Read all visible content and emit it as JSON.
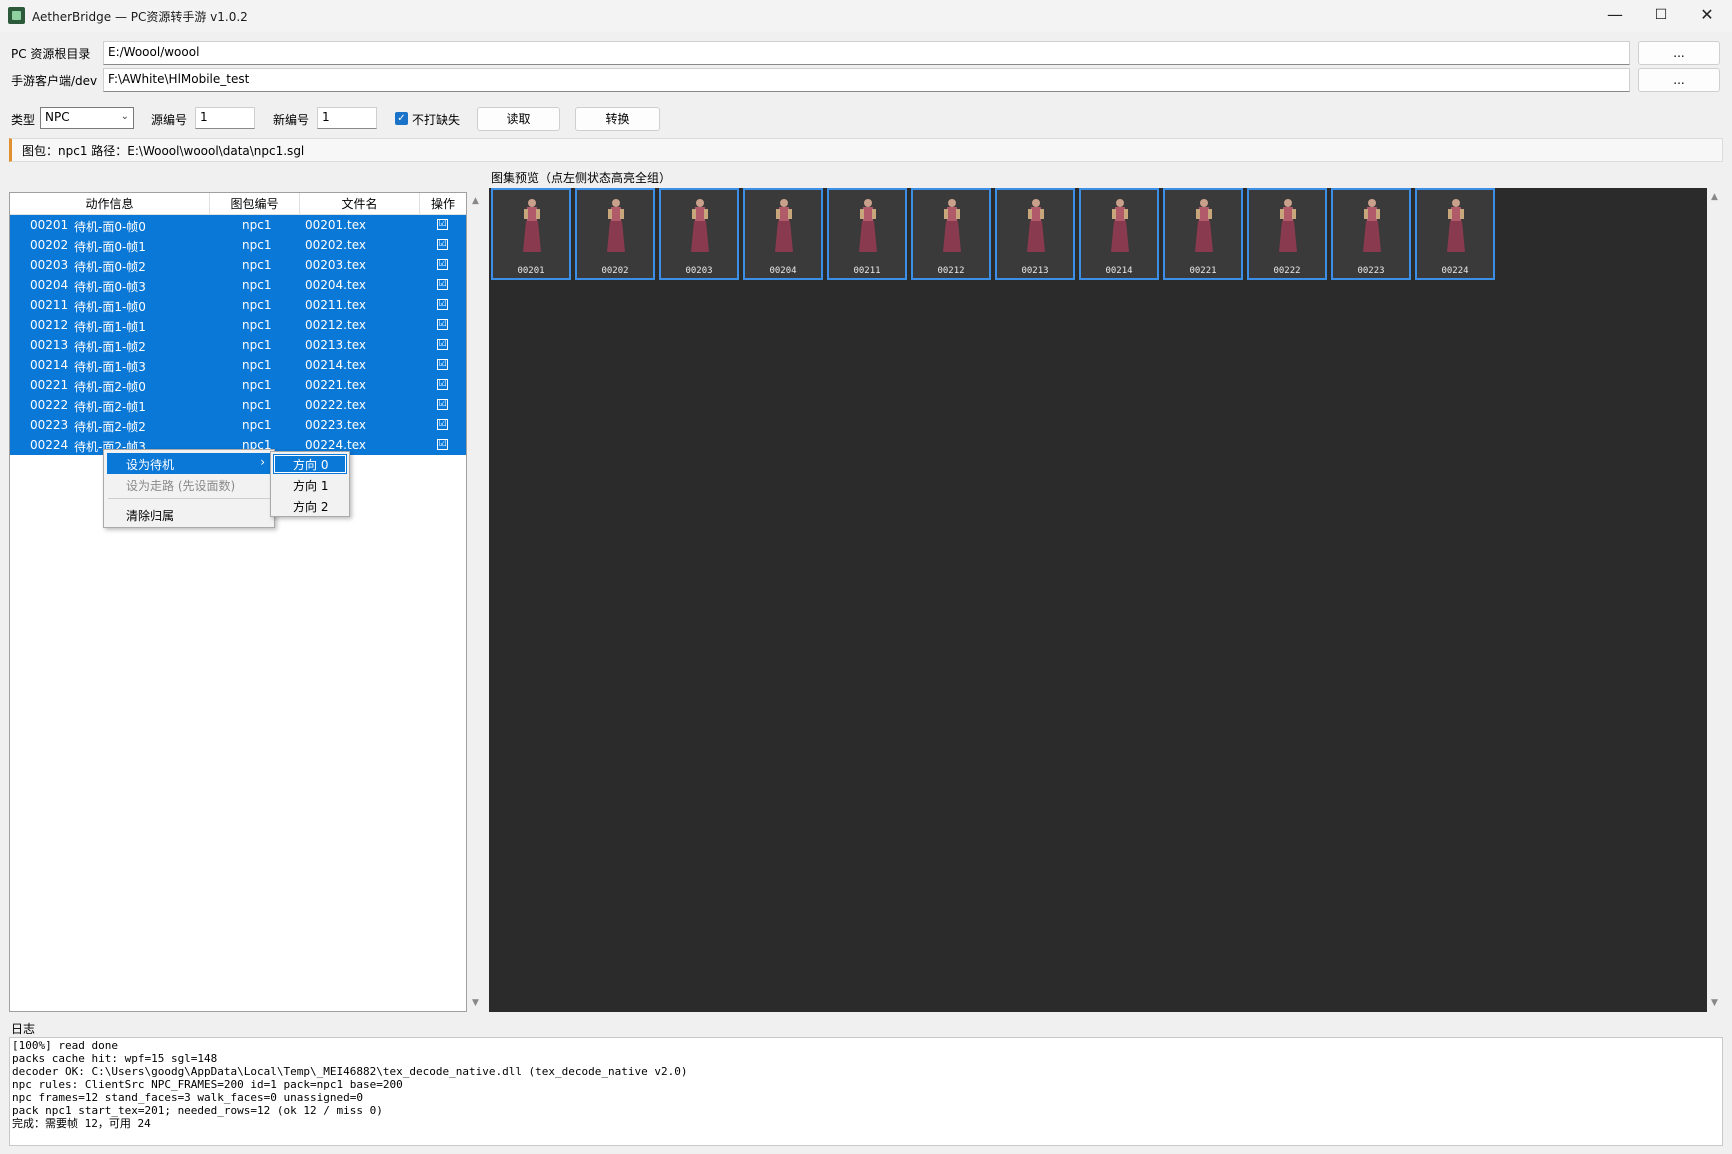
{
  "window": {
    "title": "AetherBridge — PC资源转手游  v1.0.2",
    "minimize": "—",
    "maximize": "☐",
    "close": "✕"
  },
  "paths": {
    "pc_label": "PC 资源根目录",
    "pc_value": "E:/Woool/woool",
    "mobile_label": "手游客户端/dev",
    "mobile_value": "F:\\AWhite\\HlMobile_test",
    "browse_label": "..."
  },
  "controls": {
    "type_label": "类型",
    "type_value": "NPC",
    "src_label": "源编号",
    "src_value": "1",
    "new_label": "新编号",
    "new_value": "1",
    "checkbox_label": "不打缺失",
    "checkbox_checked": true,
    "read_label": "读取",
    "convert_label": "转换"
  },
  "info": "图包：npc1    路径：E:\\Woool\\woool\\data\\npc1.sgl",
  "table": {
    "headers": [
      "动作信息",
      "图包编号",
      "文件名",
      "操作"
    ],
    "rows": [
      {
        "id": "00201",
        "action": "待机-面0-帧0",
        "pack": "npc1",
        "file": "00201.tex",
        "op": "☑"
      },
      {
        "id": "00202",
        "action": "待机-面0-帧1",
        "pack": "npc1",
        "file": "00202.tex",
        "op": "☑"
      },
      {
        "id": "00203",
        "action": "待机-面0-帧2",
        "pack": "npc1",
        "file": "00203.tex",
        "op": "☑"
      },
      {
        "id": "00204",
        "action": "待机-面0-帧3",
        "pack": "npc1",
        "file": "00204.tex",
        "op": "☑"
      },
      {
        "id": "00211",
        "action": "待机-面1-帧0",
        "pack": "npc1",
        "file": "00211.tex",
        "op": "☑"
      },
      {
        "id": "00212",
        "action": "待机-面1-帧1",
        "pack": "npc1",
        "file": "00212.tex",
        "op": "☑"
      },
      {
        "id": "00213",
        "action": "待机-面1-帧2",
        "pack": "npc1",
        "file": "00213.tex",
        "op": "☑"
      },
      {
        "id": "00214",
        "action": "待机-面1-帧3",
        "pack": "npc1",
        "file": "00214.tex",
        "op": "☑"
      },
      {
        "id": "00221",
        "action": "待机-面2-帧0",
        "pack": "npc1",
        "file": "00221.tex",
        "op": "☑"
      },
      {
        "id": "00222",
        "action": "待机-面2-帧1",
        "pack": "npc1",
        "file": "00222.tex",
        "op": "☑"
      },
      {
        "id": "00223",
        "action": "待机-面2-帧2",
        "pack": "npc1",
        "file": "00223.tex",
        "op": "☑"
      },
      {
        "id": "00224",
        "action": "待机-面2-帧3",
        "pack": "npc1",
        "file": "00224.tex",
        "op": "☑"
      }
    ]
  },
  "preview": {
    "label": "图集预览（点左侧状态高亮全组）",
    "thumbs": [
      "00201",
      "00202",
      "00203",
      "00204",
      "00211",
      "00212",
      "00213",
      "00214",
      "00221",
      "00222",
      "00223",
      "00224"
    ]
  },
  "context_menu": {
    "items": [
      "设为待机",
      "设为走路 (先设面数)",
      "清除归属"
    ],
    "submenu_arrow": "›",
    "submenu": [
      "方向 0",
      "方向 1",
      "方向 2"
    ]
  },
  "log": {
    "label": "日志",
    "lines": [
      "[100%] read done",
      "packs cache hit: wpf=15 sgl=148",
      "decoder OK: C:\\Users\\goodg\\AppData\\Local\\Temp\\_MEI46882\\tex_decode_native.dll (tex_decode_native v2.0)",
      "npc rules: ClientSrc NPC_FRAMES=200 id=1 pack=npc1 base=200",
      "npc frames=12 stand_faces=3 walk_faces=0 unassigned=0",
      "pack npc1 start_tex=201; needed_rows=12 (ok 12 / miss 0)",
      "完成：需要帧 12，可用 24"
    ]
  },
  "colors": {
    "selection": "#0a78d7",
    "preview_bg": "#2b2b2b",
    "thumb_border": "#3c8fe6",
    "accent_strip": "#e09030"
  },
  "icons": {
    "app": "app-icon",
    "dropdown": "chevron-down-icon",
    "scroll_up": "scroll-up-icon",
    "scroll_down": "scroll-down-icon"
  }
}
